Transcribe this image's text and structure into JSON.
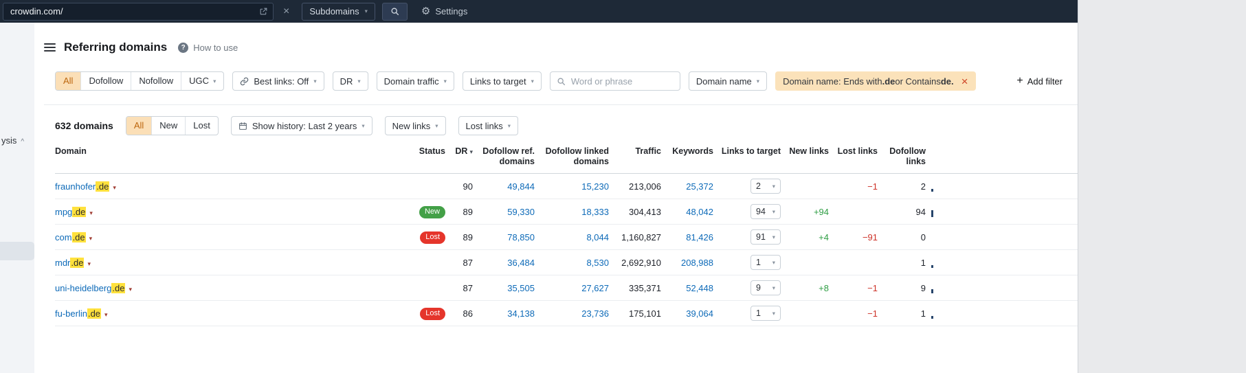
{
  "colors": {
    "topbar_bg": "#1e2937",
    "accent_orange": "#bc660d",
    "selected_tab_bg": "#fbdfb7",
    "filter_chip_bg": "#fbe2ba",
    "link_blue": "#0d6ab8",
    "positive_green": "#2f9e44",
    "negative_red": "#cd3228",
    "badge_new_green": "#43a047",
    "badge_lost_red": "#e5352b",
    "match_highlight_yellow": "#ffe13d"
  },
  "icons": {
    "caret_down": "▾",
    "close": "×",
    "gear": "⚙",
    "plus": "+",
    "question": "?",
    "collapse": "^"
  },
  "topbar": {
    "url": "crowdin.com/",
    "scope": "Subdomains",
    "settings": "Settings"
  },
  "sidebar": {
    "collapsed_text": "ysis"
  },
  "header": {
    "title": "Referring domains",
    "help": "How to use"
  },
  "filters": {
    "tabs": [
      "All",
      "Dofollow",
      "Nofollow",
      "UGC"
    ],
    "selected_tab": "All",
    "best_links": "Best links: Off",
    "dr": "DR",
    "domain_traffic": "Domain traffic",
    "links_to_target": "Links to target",
    "search_placeholder": "Word or phrase",
    "domain_name": "Domain name",
    "chip": {
      "prefix": "Domain name: Ends with ",
      "strong1": ".de",
      "middle": " or Contains ",
      "strong2": "de."
    },
    "add_filter": "Add filter"
  },
  "toolbar": {
    "count": "632 domains",
    "tabs": [
      "All",
      "New",
      "Lost"
    ],
    "selected_tab": "All",
    "show_history": "Show history: Last 2 years",
    "new_links": "New links",
    "lost_links": "Lost links"
  },
  "table": {
    "columns": [
      "Domain",
      "Status",
      "DR",
      "Dofollow ref. domains",
      "Dofollow linked domains",
      "Traffic",
      "Keywords",
      "Links to target",
      "New links",
      "Lost links",
      "Dofollow links"
    ],
    "sorted_by": "DR",
    "rows": [
      {
        "domain": "fraunhofer",
        "match": ".de",
        "status": "",
        "dr": "90",
        "dofollow_ref": "49,844",
        "dofollow_linked": "15,230",
        "traffic": "213,006",
        "keywords": "25,372",
        "links_to_target": "2",
        "new_links": "",
        "lost_links": "−1",
        "dofollow_links": "2",
        "spark": 4
      },
      {
        "domain": "mpg",
        "match": ".de",
        "status": "New",
        "dr": "89",
        "dofollow_ref": "59,330",
        "dofollow_linked": "18,333",
        "traffic": "304,413",
        "keywords": "48,042",
        "links_to_target": "94",
        "new_links": "+94",
        "lost_links": "",
        "dofollow_links": "94",
        "spark": 10
      },
      {
        "domain": "com",
        "match": ".de",
        "status": "Lost",
        "dr": "89",
        "dofollow_ref": "78,850",
        "dofollow_linked": "8,044",
        "traffic": "1,160,827",
        "keywords": "81,426",
        "links_to_target": "91",
        "new_links": "+4",
        "lost_links": "−91",
        "dofollow_links": "0",
        "spark": 0
      },
      {
        "domain": "mdr",
        "match": ".de",
        "status": "",
        "dr": "87",
        "dofollow_ref": "36,484",
        "dofollow_linked": "8,530",
        "traffic": "2,692,910",
        "keywords": "208,988",
        "links_to_target": "1",
        "new_links": "",
        "lost_links": "",
        "dofollow_links": "1",
        "spark": 4
      },
      {
        "domain": "uni-heidelberg",
        "match": ".de",
        "status": "",
        "dr": "87",
        "dofollow_ref": "35,505",
        "dofollow_linked": "27,627",
        "traffic": "335,371",
        "keywords": "52,448",
        "links_to_target": "9",
        "new_links": "+8",
        "lost_links": "−1",
        "dofollow_links": "9",
        "spark": 6
      },
      {
        "domain": "fu-berlin",
        "match": ".de",
        "status": "Lost",
        "dr": "86",
        "dofollow_ref": "34,138",
        "dofollow_linked": "23,736",
        "traffic": "175,101",
        "keywords": "39,064",
        "links_to_target": "1",
        "new_links": "",
        "lost_links": "−1",
        "dofollow_links": "1",
        "spark": 4
      }
    ]
  }
}
